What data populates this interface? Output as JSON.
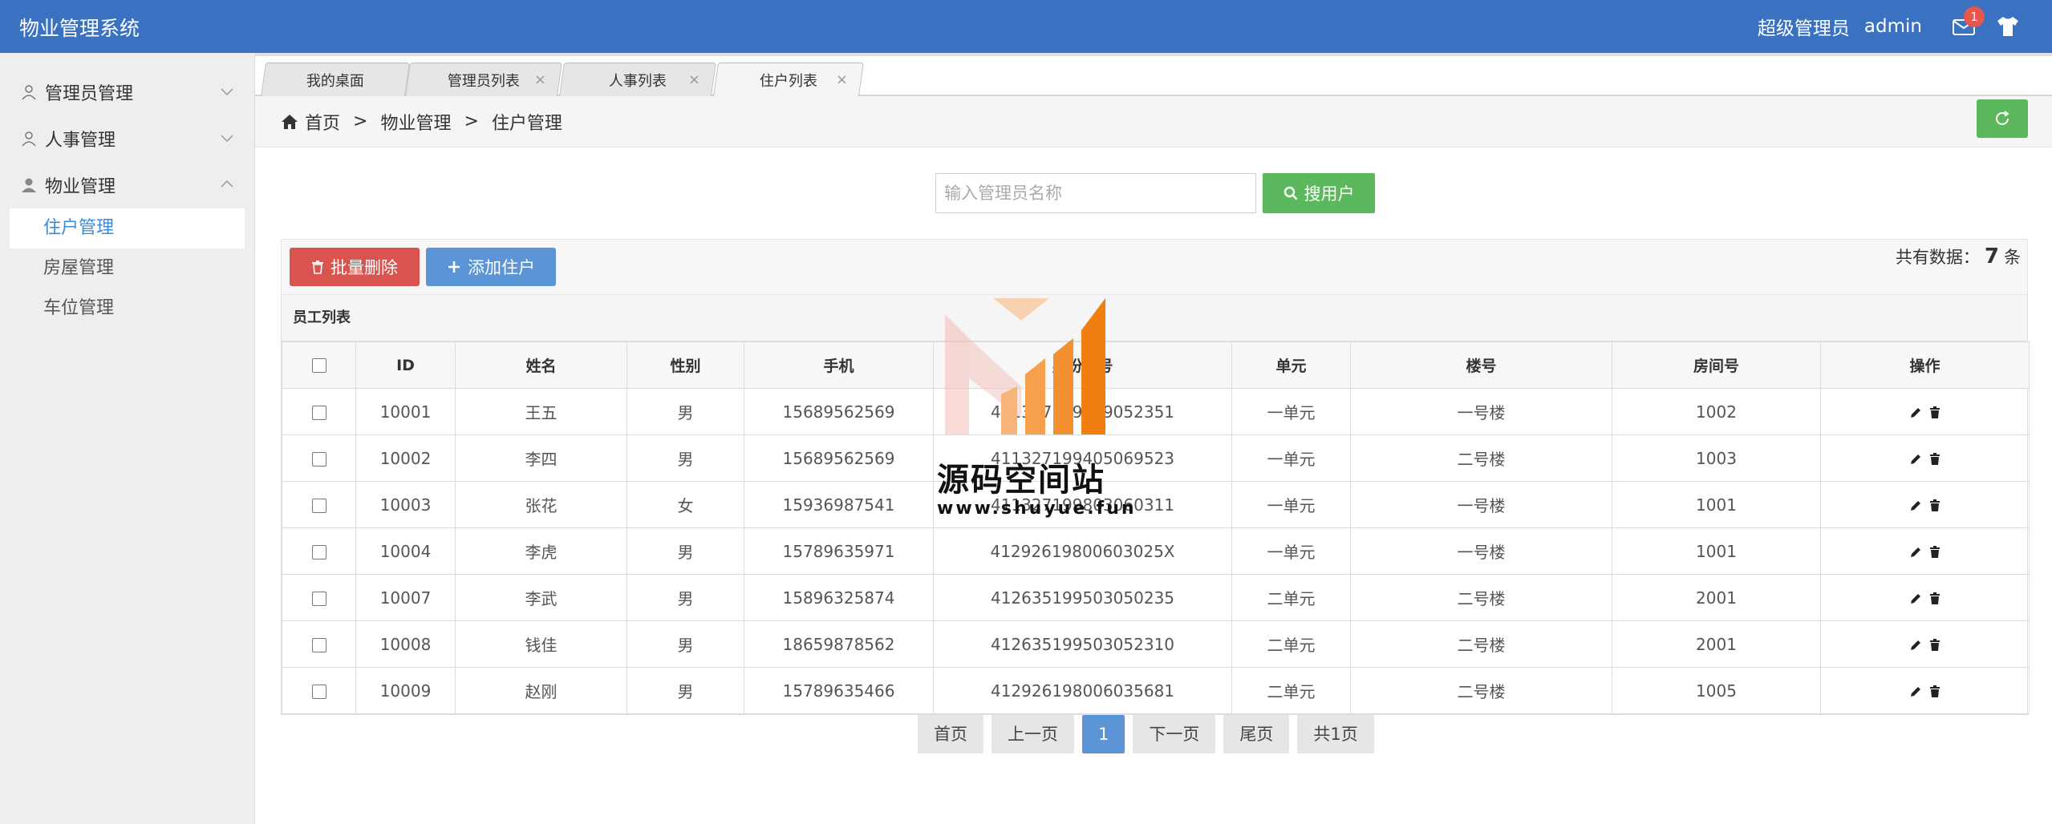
{
  "app": {
    "title": "物业管理系统"
  },
  "header": {
    "role": "超级管理员",
    "user": "admin",
    "mail_badge": "1",
    "icons": [
      "mail-icon",
      "shirt-icon"
    ]
  },
  "sidebar": {
    "groups": [
      {
        "label": "管理员管理",
        "expanded": false
      },
      {
        "label": "人事管理",
        "expanded": false
      },
      {
        "label": "物业管理",
        "expanded": true
      }
    ],
    "subitems": [
      {
        "label": "住户管理",
        "active": true
      },
      {
        "label": "房屋管理",
        "active": false
      },
      {
        "label": "车位管理",
        "active": false
      }
    ]
  },
  "tabs": [
    {
      "label": "我的桌面"
    },
    {
      "label": "管理员列表"
    },
    {
      "label": "人事列表"
    },
    {
      "label": "住户列表"
    }
  ],
  "breadcrumb": {
    "home": "首页",
    "sep": ">",
    "level1": "物业管理",
    "level2": "住户管理"
  },
  "search": {
    "placeholder": "输入管理员名称",
    "value": "",
    "button": "搜用户"
  },
  "actions": {
    "batch_delete": "批量删除",
    "add": "添加住户"
  },
  "summary": {
    "prefix": "共有数据：",
    "count": "7",
    "suffix": "条"
  },
  "table": {
    "title": "员工列表",
    "columns": [
      "ID",
      "姓名",
      "性别",
      "手机",
      "身份证号",
      "单元",
      "楼号",
      "房间号",
      "操作"
    ],
    "rows": [
      [
        "10001",
        "王五",
        "男",
        "15689562569",
        "411327199509052351",
        "一单元",
        "一号楼",
        "1002"
      ],
      [
        "10002",
        "李四",
        "男",
        "15689562569",
        "411327199405069523",
        "一单元",
        "二号楼",
        "1003"
      ],
      [
        "10003",
        "张花",
        "女",
        "15936987541",
        "411327199803060311",
        "一单元",
        "一号楼",
        "1001"
      ],
      [
        "10004",
        "李虎",
        "男",
        "15789635971",
        "41292619800603025X",
        "一单元",
        "一号楼",
        "1001"
      ],
      [
        "10007",
        "李武",
        "男",
        "15896325874",
        "412635199503050235",
        "二单元",
        "二号楼",
        "2001"
      ],
      [
        "10008",
        "钱佳",
        "男",
        "18659878562",
        "412635199503052310",
        "二单元",
        "二号楼",
        "2001"
      ],
      [
        "10009",
        "赵刚",
        "男",
        "15789635466",
        "412926198006035681",
        "二单元",
        "二号楼",
        "1005"
      ]
    ]
  },
  "pagination": {
    "first": "首页",
    "prev": "上一页",
    "current": "1",
    "next": "下一页",
    "last": "尾页",
    "total": "共1页"
  },
  "watermark": {
    "text": "源码空间站",
    "url": "www.shuyue.fun"
  },
  "colors": {
    "topbar": "#3a71c1",
    "success": "#5cb85c",
    "danger": "#d9534f",
    "primary": "#5b95d6",
    "active_link": "#3a8ad6"
  }
}
